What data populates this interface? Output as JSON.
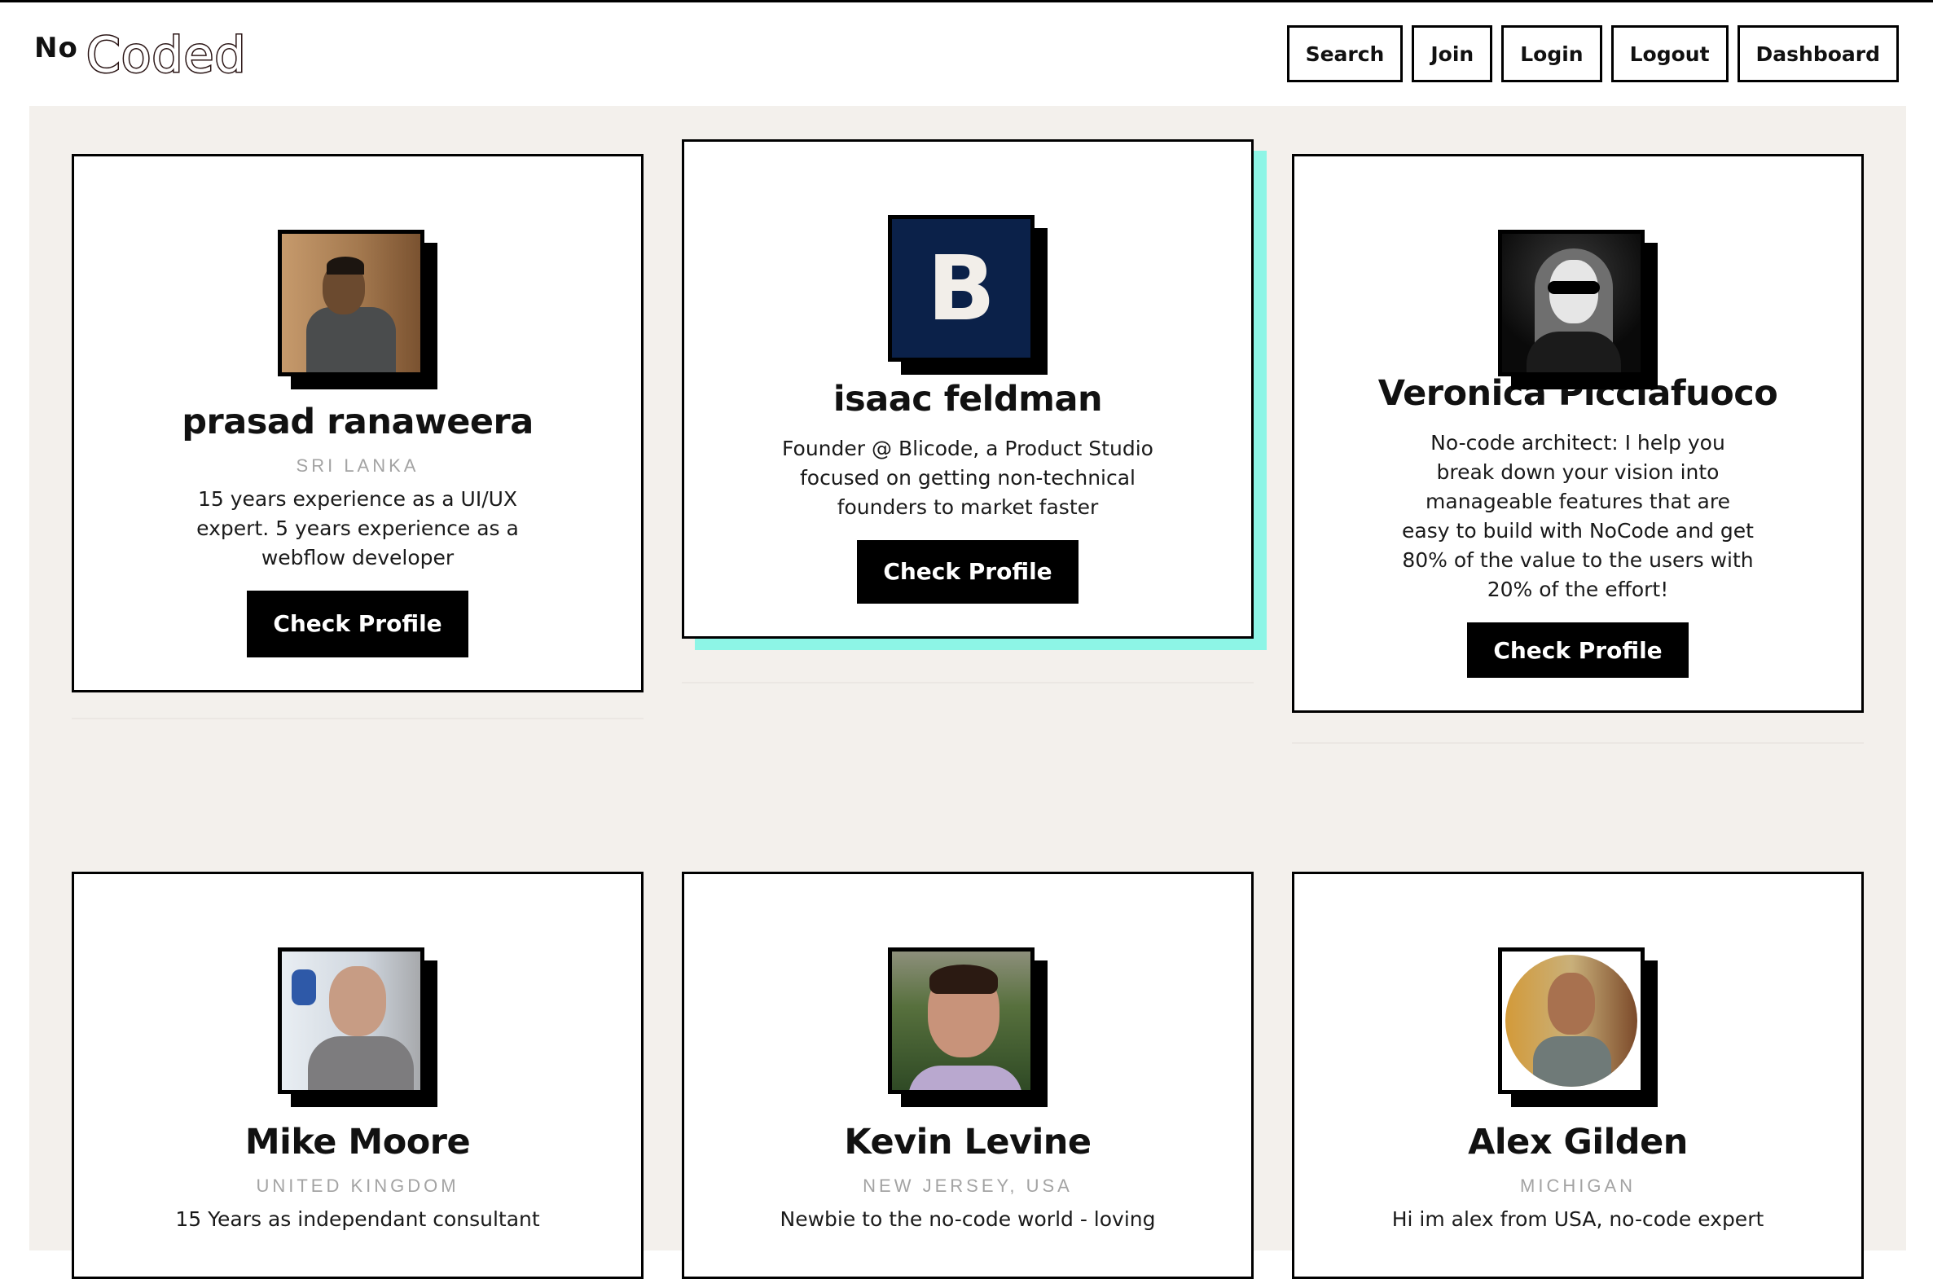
{
  "header": {
    "logo_no": "No",
    "logo_coded": "Coded",
    "nav": [
      "Search",
      "Join",
      "Login",
      "Logout",
      "Dashboard"
    ]
  },
  "cards": [
    {
      "name": "prasad ranaweera",
      "location": "SRI LANKA",
      "bio": "15 years experience as a UI/UX expert. 5 years experience as a webflow developer",
      "button": "Check Profile"
    },
    {
      "name": "isaac feldman",
      "avatar_letter": "B",
      "bio": "Founder @ Blicode, a Product Studio focused on getting non-technical founders to market faster",
      "button": "Check Profile"
    },
    {
      "name": "Veronica Picciafuoco",
      "bio": "No-code architect: I help you break down your vision into manageable features that are easy to build with NoCode and get 80% of the value to the users with 20% of the effort!",
      "button": "Check Profile"
    },
    {
      "name": "Mike Moore",
      "location": "UNITED KINGDOM",
      "bio": "15 Years as independant consultant"
    },
    {
      "name": "Kevin Levine",
      "location": "NEW JERSEY, USA",
      "bio": "Newbie to the no-code world - loving"
    },
    {
      "name": "Alex Gilden",
      "location": "MICHIGAN",
      "bio": "Hi im alex from USA, no-code expert"
    }
  ],
  "colors": {
    "accent_shadow": "#8df5e6",
    "background": "#f3f0ec",
    "button": "#000000",
    "isaac_avatar_bg": "#0b2149"
  }
}
